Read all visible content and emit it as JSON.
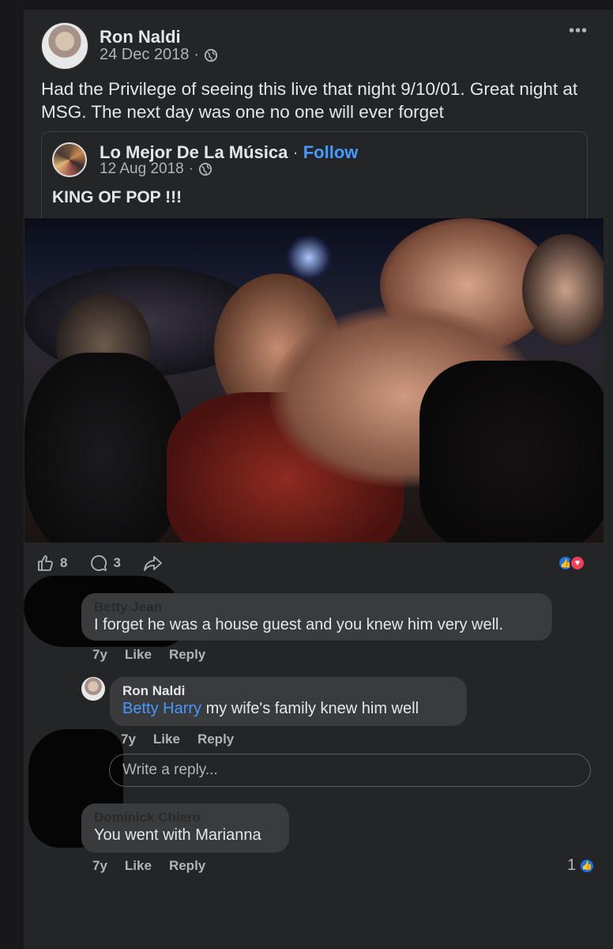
{
  "post": {
    "author": "Ron Naldi",
    "date": "24 Dec 2018",
    "separator": "·",
    "more_label": "•••",
    "text": "Had the Privilege of seeing this live that night 9/10/01. Great night at MSG. The next day was one no one will ever forget"
  },
  "shared": {
    "author": "Lo Mejor De La Música",
    "separator": "·",
    "follow_label": "Follow",
    "date": "12 Aug 2018",
    "text": "KING OF POP !!!"
  },
  "actions": {
    "likes": "8",
    "comments": "3"
  },
  "comments": [
    {
      "author": "Betty Jean",
      "text": "I forget he was a house guest and you knew him very well.",
      "time": "7y",
      "like_label": "Like",
      "reply_label": "Reply"
    },
    {
      "author": "Ron Naldi",
      "mention": "Betty Harry",
      "text": " my wife's family knew him well",
      "time": "7y",
      "like_label": "Like",
      "reply_label": "Reply"
    },
    {
      "author": "Dominick Chiero",
      "text": "You went with Marianna",
      "time": "7y",
      "like_label": "Like",
      "reply_label": "Reply",
      "reaction_count": "1"
    }
  ],
  "reply_box": {
    "placeholder": "Write a reply..."
  },
  "colors": {
    "background": "#18181a",
    "card": "#242527",
    "bubble": "#3a3b3c",
    "accent": "#4599ff"
  }
}
